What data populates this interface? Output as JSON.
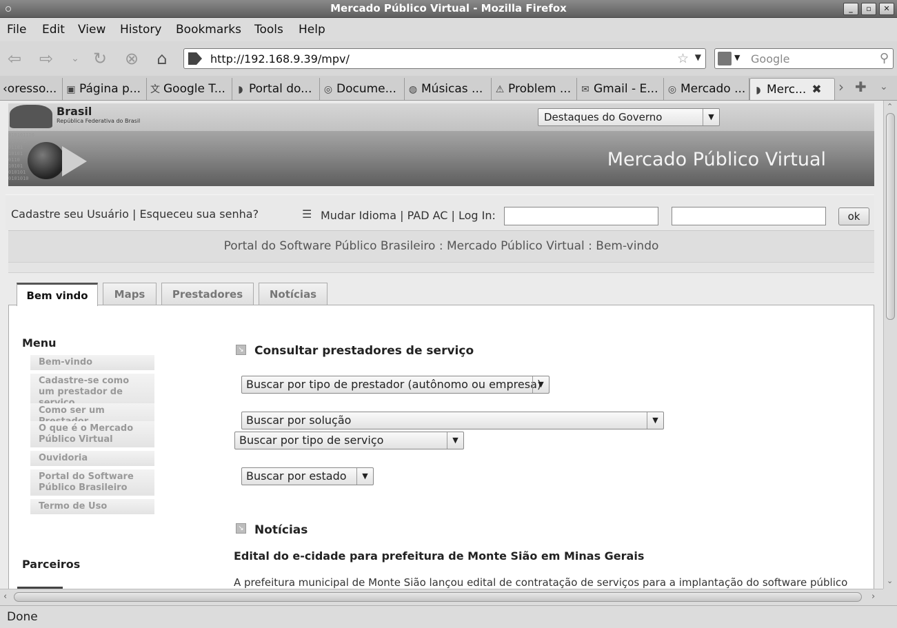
{
  "window": {
    "title": "Mercado Público Virtual - Mozilla Firefox"
  },
  "menubar": {
    "items": [
      "File",
      "Edit",
      "View",
      "History",
      "Bookmarks",
      "Tools",
      "Help"
    ]
  },
  "navbar": {
    "url": "http://192.168.9.39/mpv/",
    "search_placeholder": "Google"
  },
  "tabs": [
    {
      "label": "‹oresso...",
      "icon": "page-icon"
    },
    {
      "label": "Página p...",
      "icon": "page-icon"
    },
    {
      "label": "Google T...",
      "icon": "translate-icon"
    },
    {
      "label": "Portal do...",
      "icon": "site-icon"
    },
    {
      "label": "Docume...",
      "icon": "circle-icon"
    },
    {
      "label": "Músicas ...",
      "icon": "globe-icon"
    },
    {
      "label": "Problem ...",
      "icon": "warning-icon"
    },
    {
      "label": "Gmail - E...",
      "icon": "mail-icon"
    },
    {
      "label": "Mercado ...",
      "icon": "circle-icon"
    },
    {
      "label": "Merc...",
      "icon": "site-icon",
      "active": true
    }
  ],
  "header": {
    "brand_name": "Brasil",
    "brand_sub": "República Federativa do Brasil",
    "destaques_select": "Destaques do Governo",
    "site_title": "Mercado Público Virtual",
    "binary_text": "010101110\n0100010\n01101\n10101\n0110\n10101\n010101\n0101010"
  },
  "login": {
    "links": "Cadastre seu Usuário | Esqueceu sua senha?",
    "label": "Mudar Idioma | PAD AC | Log In:",
    "ok": "ok"
  },
  "breadcrumb": "Portal do Software Público Brasileiro : Mercado Público Virtual : Bem-vindo",
  "page_tabs": [
    "Bem vindo",
    "Maps",
    "Prestadores",
    "Notícias"
  ],
  "sidebar": {
    "menu_title": "Menu",
    "items": [
      "Bem-vindo",
      "Cadastre-se como um prestador de serviço",
      "Como ser um Prestador",
      "O que é o Mercado Público Virtual",
      "Ouvidoria",
      "Portal do Software Público Brasileiro",
      "Termo de Uso"
    ],
    "partners_title": "Parceiros"
  },
  "main": {
    "section1_title": "Consultar prestadores de serviço",
    "selects": {
      "tipo_prestador": "Buscar por tipo de prestador (autônomo ou empresa)",
      "solucao": "Buscar por solução",
      "tipo_servico": "Buscar por tipo de serviço",
      "estado": "Buscar por estado"
    },
    "section2_title": "Notícias",
    "news_headline": "Edital do e-cidade para prefeitura de Monte Sião em Minas Gerais",
    "news_body": "A prefeitura municipal de Monte Sião lançou edital de contratação de serviços para a implantação do software público"
  },
  "status": "Done"
}
